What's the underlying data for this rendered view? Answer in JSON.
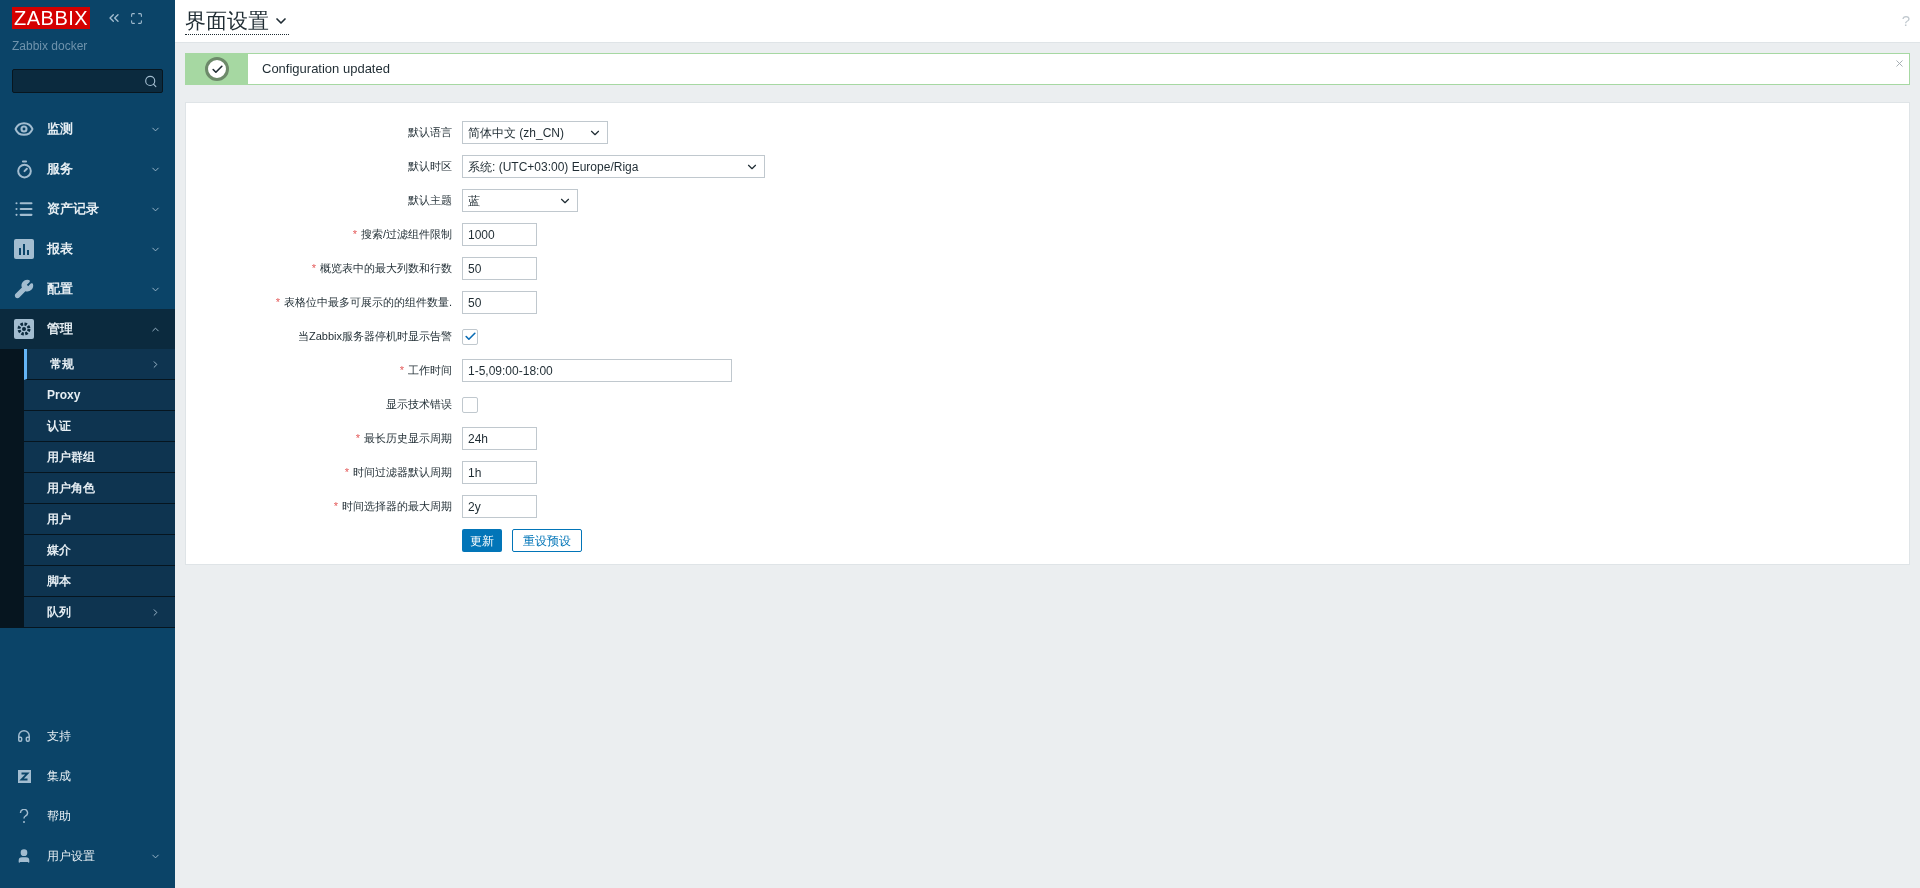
{
  "sidebar": {
    "logo": "ZABBIX",
    "server_name": "Zabbix docker",
    "menu": [
      {
        "label": "监测",
        "expanded": false
      },
      {
        "label": "服务",
        "expanded": false
      },
      {
        "label": "资产记录",
        "expanded": false
      },
      {
        "label": "报表",
        "expanded": false
      },
      {
        "label": "配置",
        "expanded": false
      },
      {
        "label": "管理",
        "expanded": true,
        "children": [
          {
            "label": "常规",
            "selected": true,
            "submenu": true
          },
          {
            "label": "Proxy",
            "selected": false,
            "submenu": false
          },
          {
            "label": "认证",
            "selected": false,
            "submenu": false
          },
          {
            "label": "用户群组",
            "selected": false,
            "submenu": false
          },
          {
            "label": "用户角色",
            "selected": false,
            "submenu": false
          },
          {
            "label": "用户",
            "selected": false,
            "submenu": false
          },
          {
            "label": "媒介",
            "selected": false,
            "submenu": false
          },
          {
            "label": "脚本",
            "selected": false,
            "submenu": false
          },
          {
            "label": "队列",
            "selected": false,
            "submenu": true
          }
        ]
      }
    ],
    "bottom_menu": [
      {
        "label": "支持",
        "submenu": false
      },
      {
        "label": "集成",
        "submenu": false
      },
      {
        "label": "帮助",
        "submenu": false
      },
      {
        "label": "用户设置",
        "submenu": true
      }
    ]
  },
  "header": {
    "title": "界面设置",
    "help": "?"
  },
  "message": {
    "text": "Configuration updated"
  },
  "form": {
    "fields": [
      {
        "kind": "select",
        "label": "默认语言",
        "value": "简体中文 (zh_CN)"
      },
      {
        "kind": "select",
        "label": "默认时区",
        "value": "系统: (UTC+03:00) Europe/Riga"
      },
      {
        "kind": "select",
        "label": "默认主题",
        "value": "蓝"
      },
      {
        "kind": "text",
        "marker": "*",
        "label": "搜索/过滤组件限制",
        "value": "1000"
      },
      {
        "kind": "text",
        "marker": "*",
        "label": "概览表中的最大列数和行数",
        "value": "50"
      },
      {
        "kind": "text",
        "marker": "*",
        "label": "表格位中最多可展示的的组件数量.",
        "value": "50"
      },
      {
        "kind": "checkbox",
        "label": "当Zabbix服务器停机时显示告警",
        "checked": true
      },
      {
        "kind": "text",
        "marker": "*",
        "label": "工作时间",
        "value": "1-5,09:00-18:00"
      },
      {
        "kind": "checkbox",
        "label": "显示技术错误",
        "checked": false
      },
      {
        "kind": "text",
        "marker": "*",
        "label": "最长历史显示周期",
        "value": "24h"
      },
      {
        "kind": "text",
        "marker": "*",
        "label": "时间过滤器默认周期",
        "value": "1h"
      },
      {
        "kind": "text",
        "marker": "*",
        "label": "时间选择器的最大周期",
        "value": "2y"
      }
    ],
    "buttons": [
      {
        "label": "更新",
        "kind": "primary"
      },
      {
        "label": "重设预设",
        "kind": "secondary"
      }
    ]
  }
}
